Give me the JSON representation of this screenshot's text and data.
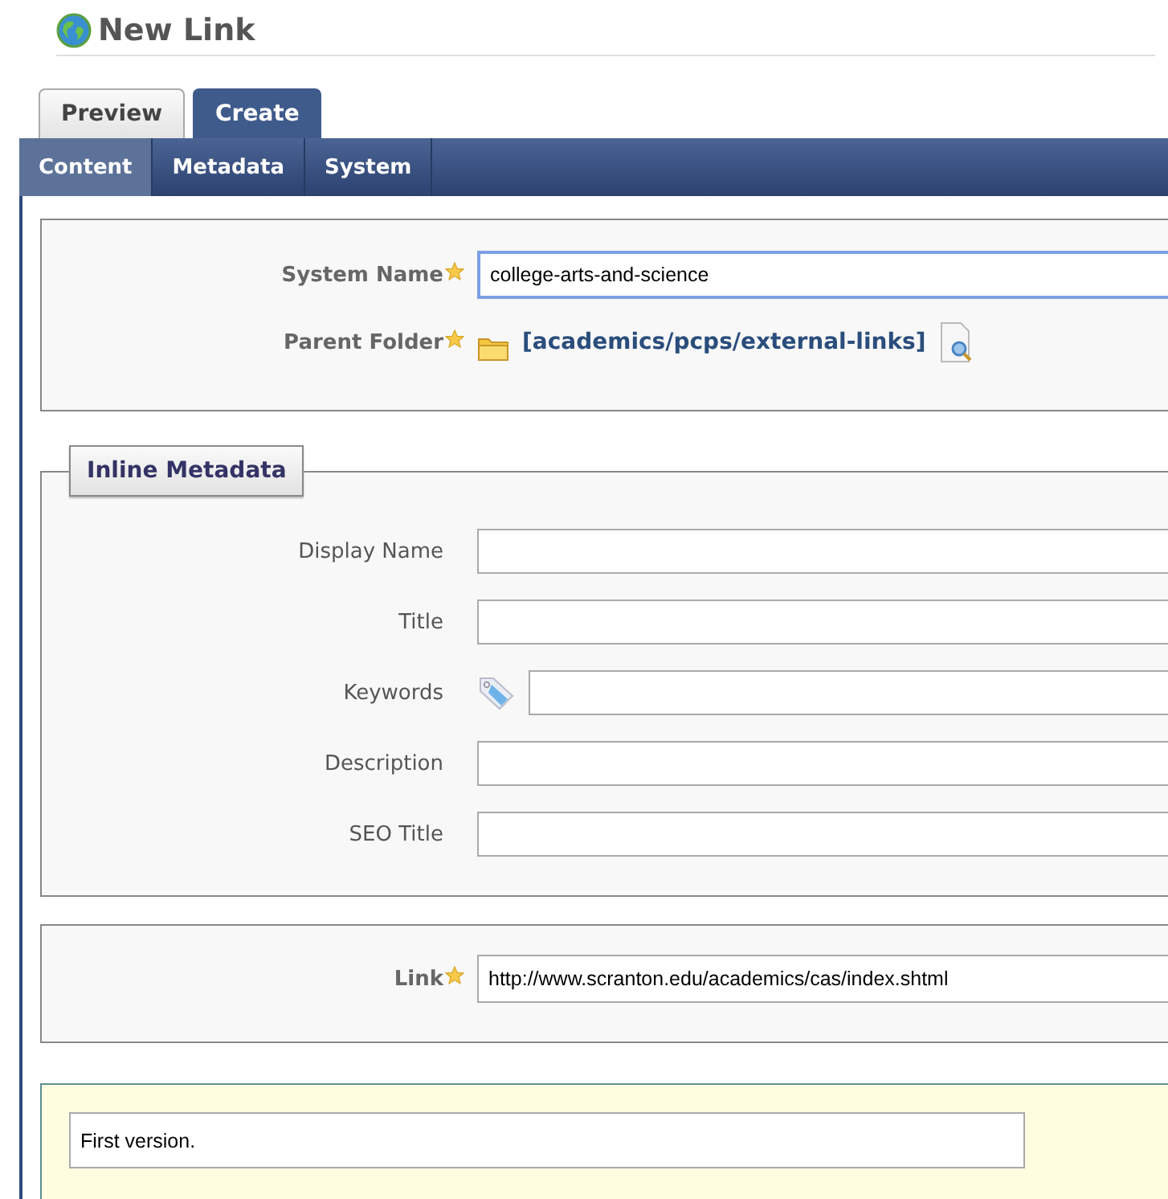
{
  "title": "New Link",
  "tabs": [
    {
      "label": "Preview",
      "selected": false
    },
    {
      "label": "Create",
      "selected": true
    }
  ],
  "subtabs": [
    {
      "label": "Content",
      "selected": true
    },
    {
      "label": "Metadata",
      "selected": false
    },
    {
      "label": "System",
      "selected": false
    }
  ],
  "system_name": {
    "label": "System Name",
    "required": true,
    "value": "college-arts-and-science",
    "focused": true
  },
  "parent_folder": {
    "label": "Parent Folder",
    "required": true,
    "path": "[academics/pcps/external-links]"
  },
  "inline_metadata": {
    "legend": "Inline Metadata",
    "fields": [
      {
        "label": "Display Name",
        "kind": "text"
      },
      {
        "label": "Title",
        "kind": "text"
      },
      {
        "label": "Keywords",
        "kind": "tags"
      },
      {
        "label": "Description",
        "kind": "text"
      },
      {
        "label": "SEO Title",
        "kind": "text"
      }
    ]
  },
  "link": {
    "label": "Link",
    "required": true,
    "value": "http://www.scranton.edu/academics/cas/index.shtml"
  },
  "comment": {
    "value": "First version."
  }
}
